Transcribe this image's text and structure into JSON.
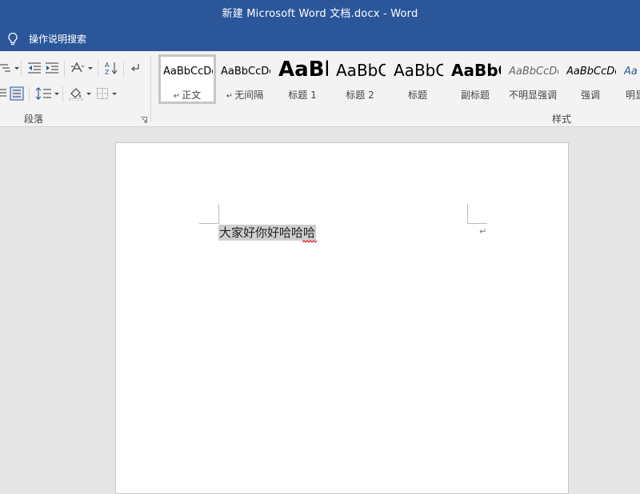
{
  "window": {
    "title": "新建 Microsoft Word 文档.docx  -  Word"
  },
  "tellme": {
    "text": "操作说明搜索"
  },
  "ribbon": {
    "paragraph_group_label": "段落",
    "styles_group_label": "样式",
    "paragraph_tools": [
      "multilevel-list-icon",
      "decrease-indent-icon",
      "increase-indent-icon",
      "chinese-layout-icon",
      "sort-icon",
      "show-hide-marks-icon",
      "align-justify-icon",
      "distributed-align-icon",
      "line-spacing-icon",
      "shading-icon",
      "borders-icon"
    ],
    "styles": [
      {
        "preview": "AaBbCcDc",
        "label": "正文",
        "mark": "↵",
        "selected": true
      },
      {
        "preview": "AaBbCcDc",
        "label": "无间隔",
        "mark": "↵"
      },
      {
        "preview": "AaBl",
        "label": "标题 1"
      },
      {
        "preview": "AaBbC",
        "label": "标题 2"
      },
      {
        "preview": "AaBbC",
        "label": "标题"
      },
      {
        "preview": "AaBbC",
        "label": "副标题"
      },
      {
        "preview": "AaBbCcDc",
        "label": "不明显强调"
      },
      {
        "preview": "AaBbCcDc",
        "label": "强调"
      },
      {
        "preview": "AaBb",
        "label": "明显"
      }
    ]
  },
  "document": {
    "text": "大家好你好哈哈哈",
    "paragraph_mark": "↵"
  },
  "colors": {
    "titlebar": "#2b579a",
    "ribbon": "#f3f3f3",
    "canvas": "#e6e6e6",
    "selection": "#cfcfcf",
    "spellcheck": "#e00000"
  }
}
